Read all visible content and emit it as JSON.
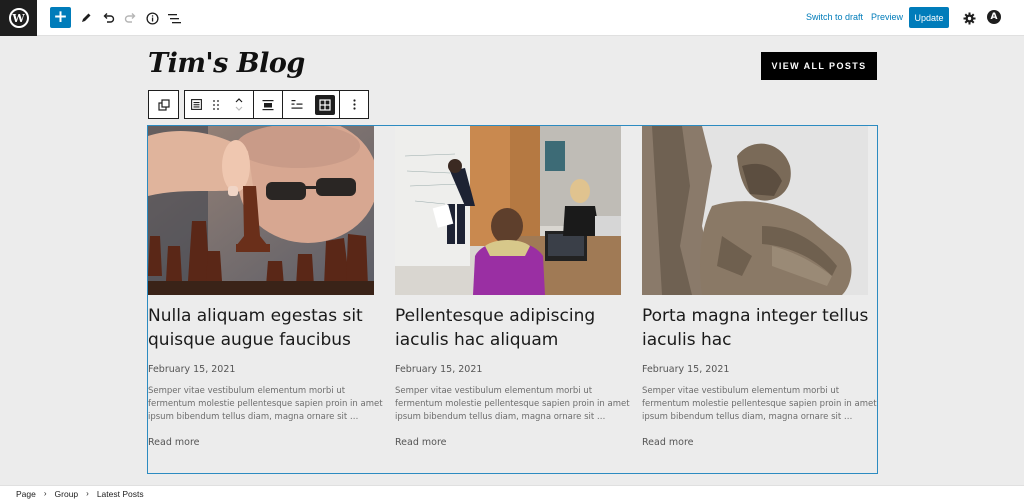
{
  "toolbar": {
    "logo_letter": "W",
    "add_label": "+",
    "switch_to_draft": "Switch to draft",
    "preview": "Preview",
    "update": "Update",
    "avatar_letter": "A"
  },
  "header": {
    "site_title": "Tim's Blog",
    "view_all_posts": "VIEW ALL POSTS"
  },
  "posts": [
    {
      "title": "Nulla aliquam egestas sit quisque augue faucibus",
      "date": "February 15, 2021",
      "excerpt": "Semper vitae vestibulum elementum morbi ut fermentum molestie pellentesque sapien proin in amet ipsum bibendum tellus diam, magna ornare sit …",
      "read_more": "Read more",
      "image": "chess-player-photo"
    },
    {
      "title": "Pellentesque adipiscing iaculis hac aliquam",
      "date": "February 15, 2021",
      "excerpt": "Semper vitae vestibulum elementum morbi ut fermentum molestie pellentesque sapien proin in amet ipsum bibendum tellus diam, magna ornare sit …",
      "read_more": "Read more",
      "image": "office-meeting-photo"
    },
    {
      "title": "Porta magna integer tellus iaculis hac",
      "date": "February 15, 2021",
      "excerpt": "Semper vitae vestibulum elementum morbi ut fermentum molestie pellentesque sapien proin in amet ipsum bibendum tellus diam, magna ornare sit …",
      "read_more": "Read more",
      "image": "stone-statue-photo"
    }
  ],
  "breadcrumb": [
    "Page",
    "Group",
    "Latest Posts"
  ],
  "colors": {
    "accent": "#007cba",
    "selection": "#2c8bc1",
    "dark": "#1e1e1e",
    "canvas": "#ececec"
  }
}
